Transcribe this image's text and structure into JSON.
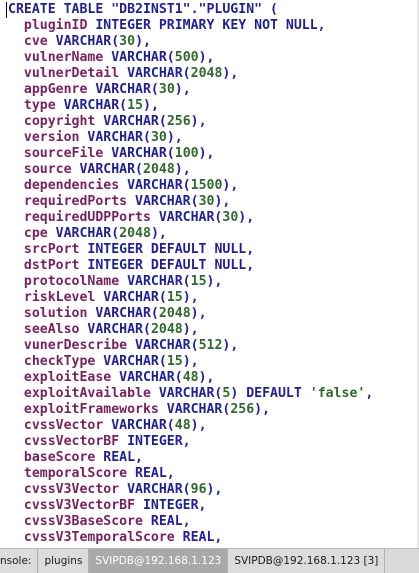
{
  "editor": {
    "lines": [
      [
        {
          "t": "CREATE TABLE ",
          "c": "kw"
        },
        {
          "t": "\"DB2INST1\".\"PLUGIN\" (",
          "c": "plain"
        }
      ],
      [
        {
          "t": "  pluginID ",
          "c": "id"
        },
        {
          "t": "INTEGER PRIMARY KEY NOT NULL,",
          "c": "kw"
        }
      ],
      [
        {
          "t": "  cve ",
          "c": "id"
        },
        {
          "t": "VARCHAR(",
          "c": "kw"
        },
        {
          "t": "30",
          "c": "num"
        },
        {
          "t": "),",
          "c": "pun"
        }
      ],
      [
        {
          "t": "  vulnerName ",
          "c": "id"
        },
        {
          "t": "VARCHAR(",
          "c": "kw"
        },
        {
          "t": "500",
          "c": "num"
        },
        {
          "t": "),",
          "c": "pun"
        }
      ],
      [
        {
          "t": "  vulnerDetail ",
          "c": "id"
        },
        {
          "t": "VARCHAR(",
          "c": "kw"
        },
        {
          "t": "2048",
          "c": "num"
        },
        {
          "t": "),",
          "c": "pun"
        }
      ],
      [
        {
          "t": "  appGenre ",
          "c": "id"
        },
        {
          "t": "VARCHAR(",
          "c": "kw"
        },
        {
          "t": "30",
          "c": "num"
        },
        {
          "t": "),",
          "c": "pun"
        }
      ],
      [
        {
          "t": "  type ",
          "c": "id"
        },
        {
          "t": "VARCHAR(",
          "c": "kw"
        },
        {
          "t": "15",
          "c": "num"
        },
        {
          "t": "),",
          "c": "pun"
        }
      ],
      [
        {
          "t": "  copyright ",
          "c": "id"
        },
        {
          "t": "VARCHAR(",
          "c": "kw"
        },
        {
          "t": "256",
          "c": "num"
        },
        {
          "t": "),",
          "c": "pun"
        }
      ],
      [
        {
          "t": "  version ",
          "c": "id"
        },
        {
          "t": "VARCHAR(",
          "c": "kw"
        },
        {
          "t": "30",
          "c": "num"
        },
        {
          "t": "),",
          "c": "pun"
        }
      ],
      [
        {
          "t": "  sourceFile ",
          "c": "id"
        },
        {
          "t": "VARCHAR(",
          "c": "kw"
        },
        {
          "t": "100",
          "c": "num"
        },
        {
          "t": "),",
          "c": "pun"
        }
      ],
      [
        {
          "t": "  source ",
          "c": "id"
        },
        {
          "t": "VARCHAR(",
          "c": "kw"
        },
        {
          "t": "2048",
          "c": "num"
        },
        {
          "t": "),",
          "c": "pun"
        }
      ],
      [
        {
          "t": "  dependencies ",
          "c": "id"
        },
        {
          "t": "VARCHAR(",
          "c": "kw"
        },
        {
          "t": "1500",
          "c": "num"
        },
        {
          "t": "),",
          "c": "pun"
        }
      ],
      [
        {
          "t": "  requiredPorts ",
          "c": "id"
        },
        {
          "t": "VARCHAR(",
          "c": "kw"
        },
        {
          "t": "30",
          "c": "num"
        },
        {
          "t": "),",
          "c": "pun"
        }
      ],
      [
        {
          "t": "  requiredUDPPorts ",
          "c": "id"
        },
        {
          "t": "VARCHAR(",
          "c": "kw"
        },
        {
          "t": "30",
          "c": "num"
        },
        {
          "t": "),",
          "c": "pun"
        }
      ],
      [
        {
          "t": "  cpe ",
          "c": "id"
        },
        {
          "t": "VARCHAR(",
          "c": "kw"
        },
        {
          "t": "2048",
          "c": "num"
        },
        {
          "t": "),",
          "c": "pun"
        }
      ],
      [
        {
          "t": "  srcPort ",
          "c": "id"
        },
        {
          "t": "INTEGER DEFAULT NULL,",
          "c": "kw"
        }
      ],
      [
        {
          "t": "  dstPort ",
          "c": "id"
        },
        {
          "t": "INTEGER DEFAULT NULL,",
          "c": "kw"
        }
      ],
      [
        {
          "t": "  protocolName ",
          "c": "id"
        },
        {
          "t": "VARCHAR(",
          "c": "kw"
        },
        {
          "t": "15",
          "c": "num"
        },
        {
          "t": "),",
          "c": "pun"
        }
      ],
      [
        {
          "t": "  riskLevel ",
          "c": "id"
        },
        {
          "t": "VARCHAR(",
          "c": "kw"
        },
        {
          "t": "15",
          "c": "num"
        },
        {
          "t": "),",
          "c": "pun"
        }
      ],
      [
        {
          "t": "  solution ",
          "c": "id"
        },
        {
          "t": "VARCHAR(",
          "c": "kw"
        },
        {
          "t": "2048",
          "c": "num"
        },
        {
          "t": "),",
          "c": "pun"
        }
      ],
      [
        {
          "t": "  seeAlso ",
          "c": "id"
        },
        {
          "t": "VARCHAR(",
          "c": "kw"
        },
        {
          "t": "2048",
          "c": "num"
        },
        {
          "t": "),",
          "c": "pun"
        }
      ],
      [
        {
          "t": "  vunerDescribe ",
          "c": "id"
        },
        {
          "t": "VARCHAR(",
          "c": "kw"
        },
        {
          "t": "512",
          "c": "num"
        },
        {
          "t": "),",
          "c": "pun"
        }
      ],
      [
        {
          "t": "  checkType ",
          "c": "id"
        },
        {
          "t": "VARCHAR(",
          "c": "kw"
        },
        {
          "t": "15",
          "c": "num"
        },
        {
          "t": "),",
          "c": "pun"
        }
      ],
      [
        {
          "t": "  exploitEase ",
          "c": "id"
        },
        {
          "t": "VARCHAR(",
          "c": "kw"
        },
        {
          "t": "48",
          "c": "num"
        },
        {
          "t": "),",
          "c": "pun"
        }
      ],
      [
        {
          "t": "  exploitAvailable ",
          "c": "id"
        },
        {
          "t": "VARCHAR(",
          "c": "kw"
        },
        {
          "t": "5",
          "c": "num"
        },
        {
          "t": ") DEFAULT ",
          "c": "kw"
        },
        {
          "t": "'false'",
          "c": "str"
        },
        {
          "t": ",",
          "c": "pun"
        }
      ],
      [
        {
          "t": "  exploitFrameworks ",
          "c": "id"
        },
        {
          "t": "VARCHAR(",
          "c": "kw"
        },
        {
          "t": "256",
          "c": "num"
        },
        {
          "t": "),",
          "c": "pun"
        }
      ],
      [
        {
          "t": "  cvssVector ",
          "c": "id"
        },
        {
          "t": "VARCHAR(",
          "c": "kw"
        },
        {
          "t": "48",
          "c": "num"
        },
        {
          "t": "),",
          "c": "pun"
        }
      ],
      [
        {
          "t": "  cvssVectorBF ",
          "c": "id"
        },
        {
          "t": "INTEGER,",
          "c": "kw"
        }
      ],
      [
        {
          "t": "  baseScore ",
          "c": "id"
        },
        {
          "t": "REAL,",
          "c": "kw"
        }
      ],
      [
        {
          "t": "  temporalScore ",
          "c": "id"
        },
        {
          "t": "REAL,",
          "c": "kw"
        }
      ],
      [
        {
          "t": "  cvssV3Vector ",
          "c": "id"
        },
        {
          "t": "VARCHAR(",
          "c": "kw"
        },
        {
          "t": "96",
          "c": "num"
        },
        {
          "t": "),",
          "c": "pun"
        }
      ],
      [
        {
          "t": "  cvssV3VectorBF ",
          "c": "id"
        },
        {
          "t": "INTEGER,",
          "c": "kw"
        }
      ],
      [
        {
          "t": "  cvssV3BaseScore ",
          "c": "id"
        },
        {
          "t": "REAL,",
          "c": "kw"
        }
      ],
      [
        {
          "t": "  cvssV3TemporalScore ",
          "c": "id"
        },
        {
          "t": "REAL,",
          "c": "kw"
        }
      ]
    ]
  },
  "tabs": [
    {
      "label": "nsole:",
      "active": false
    },
    {
      "label": "plugins",
      "active": false
    },
    {
      "label": "SVIPDB@192.168.1.123",
      "active": true
    },
    {
      "label": "SVIPDB@192.168.1.123 [3]",
      "active": false
    }
  ]
}
